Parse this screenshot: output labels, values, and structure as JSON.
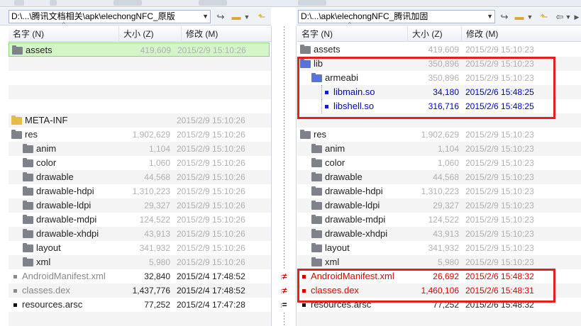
{
  "left": {
    "path": "D:\\...\\腾讯文档相关\\apk\\elechongNFC_原版",
    "rows": [
      {
        "idx": 0,
        "name": "assets",
        "size": "419,609",
        "date": "2015/2/9 15:10:26",
        "icon": "gray",
        "indent": 0,
        "style": "sel"
      },
      {
        "idx": 5,
        "name": "META-INF",
        "size": "",
        "date": "2015/2/9 15:10:26",
        "icon": "yellow",
        "indent": 0,
        "style": "folder"
      },
      {
        "idx": 6,
        "name": "res",
        "size": "1,902,629",
        "date": "2015/2/9 15:10:26",
        "icon": "gray",
        "indent": 0,
        "style": "folder"
      },
      {
        "idx": 7,
        "name": "anim",
        "size": "1,104",
        "date": "2015/2/9 15:10:26",
        "icon": "gray",
        "indent": 1,
        "style": "folder"
      },
      {
        "idx": 8,
        "name": "color",
        "size": "1,060",
        "date": "2015/2/9 15:10:26",
        "icon": "gray",
        "indent": 1,
        "style": "folder"
      },
      {
        "idx": 9,
        "name": "drawable",
        "size": "44,568",
        "date": "2015/2/9 15:10:26",
        "icon": "gray",
        "indent": 1,
        "style": "folder"
      },
      {
        "idx": 10,
        "name": "drawable-hdpi",
        "size": "1,310,223",
        "date": "2015/2/9 15:10:26",
        "icon": "gray",
        "indent": 1,
        "style": "folder"
      },
      {
        "idx": 11,
        "name": "drawable-ldpi",
        "size": "29,327",
        "date": "2015/2/9 15:10:26",
        "icon": "gray",
        "indent": 1,
        "style": "folder"
      },
      {
        "idx": 12,
        "name": "drawable-mdpi",
        "size": "124,522",
        "date": "2015/2/9 15:10:26",
        "icon": "gray",
        "indent": 1,
        "style": "folder"
      },
      {
        "idx": 13,
        "name": "drawable-xhdpi",
        "size": "43,913",
        "date": "2015/2/9 15:10:26",
        "icon": "gray",
        "indent": 1,
        "style": "folder"
      },
      {
        "idx": 14,
        "name": "layout",
        "size": "341,932",
        "date": "2015/2/9 15:10:26",
        "icon": "gray",
        "indent": 1,
        "style": "folder"
      },
      {
        "idx": 15,
        "name": "xml",
        "size": "5,980",
        "date": "2015/2/9 15:10:26",
        "icon": "gray",
        "indent": 1,
        "style": "folder"
      },
      {
        "idx": 16,
        "name": "AndroidManifest.xml",
        "size": "32,840",
        "date": "2015/2/4 17:48:52",
        "icon": "sq-grey",
        "indent": 0,
        "style": "diff"
      },
      {
        "idx": 17,
        "name": "classes.dex",
        "size": "1,437,776",
        "date": "2015/2/4 17:48:52",
        "icon": "sq-grey",
        "indent": 0,
        "style": "diff"
      },
      {
        "idx": 18,
        "name": "resources.arsc",
        "size": "77,252",
        "date": "2015/2/4 17:47:28",
        "icon": "sq-black",
        "indent": 0,
        "style": "same"
      }
    ]
  },
  "right": {
    "path": "D:\\...\\apk\\elechongNFC_腾讯加固",
    "rows": [
      {
        "idx": 0,
        "name": "assets",
        "size": "419,609",
        "date": "2015/2/9 15:10:23",
        "icon": "gray",
        "indent": 0,
        "style": "folder"
      },
      {
        "idx": 1,
        "name": "lib",
        "size": "350,896",
        "date": "2015/2/9 15:10:23",
        "icon": "blue",
        "indent": 0,
        "style": "folder"
      },
      {
        "idx": 2,
        "name": "armeabi",
        "size": "350,896",
        "date": "2015/2/9 15:10:23",
        "icon": "blue",
        "indent": 1,
        "style": "folder"
      },
      {
        "idx": 3,
        "name": "libmain.so",
        "size": "34,180",
        "date": "2015/2/6 15:48:25",
        "icon": "sq-blue",
        "indent": 2,
        "style": "new"
      },
      {
        "idx": 4,
        "name": "libshell.so",
        "size": "316,716",
        "date": "2015/2/6 15:48:25",
        "icon": "sq-blue",
        "indent": 2,
        "style": "new"
      },
      {
        "idx": 6,
        "name": "res",
        "size": "1,902,629",
        "date": "2015/2/9 15:10:23",
        "icon": "gray",
        "indent": 0,
        "style": "folder"
      },
      {
        "idx": 7,
        "name": "anim",
        "size": "1,104",
        "date": "2015/2/9 15:10:23",
        "icon": "gray",
        "indent": 1,
        "style": "folder"
      },
      {
        "idx": 8,
        "name": "color",
        "size": "1,060",
        "date": "2015/2/9 15:10:23",
        "icon": "gray",
        "indent": 1,
        "style": "folder"
      },
      {
        "idx": 9,
        "name": "drawable",
        "size": "44,568",
        "date": "2015/2/9 15:10:23",
        "icon": "gray",
        "indent": 1,
        "style": "folder"
      },
      {
        "idx": 10,
        "name": "drawable-hdpi",
        "size": "1,310,223",
        "date": "2015/2/9 15:10:23",
        "icon": "gray",
        "indent": 1,
        "style": "folder"
      },
      {
        "idx": 11,
        "name": "drawable-ldpi",
        "size": "29,327",
        "date": "2015/2/9 15:10:23",
        "icon": "gray",
        "indent": 1,
        "style": "folder"
      },
      {
        "idx": 12,
        "name": "drawable-mdpi",
        "size": "124,522",
        "date": "2015/2/9 15:10:23",
        "icon": "gray",
        "indent": 1,
        "style": "folder"
      },
      {
        "idx": 13,
        "name": "drawable-xhdpi",
        "size": "43,913",
        "date": "2015/2/9 15:10:23",
        "icon": "gray",
        "indent": 1,
        "style": "folder"
      },
      {
        "idx": 14,
        "name": "layout",
        "size": "341,932",
        "date": "2015/2/9 15:10:23",
        "icon": "gray",
        "indent": 1,
        "style": "folder"
      },
      {
        "idx": 15,
        "name": "xml",
        "size": "5,980",
        "date": "2015/2/9 15:10:23",
        "icon": "gray",
        "indent": 1,
        "style": "folder"
      },
      {
        "idx": 16,
        "name": "AndroidManifest.xml",
        "size": "26,692",
        "date": "2015/2/6 15:48:32",
        "icon": "sq-red",
        "indent": 0,
        "style": "diff"
      },
      {
        "idx": 17,
        "name": "classes.dex",
        "size": "1,460,106",
        "date": "2015/2/6 15:48:31",
        "icon": "sq-red",
        "indent": 0,
        "style": "diff"
      },
      {
        "idx": 18,
        "name": "resources.arsc",
        "size": "77,252",
        "date": "2015/2/6 15:48:32",
        "icon": "sq-black",
        "indent": 0,
        "style": "same"
      }
    ]
  },
  "columns": {
    "name": "名字 (N)",
    "size": "大小 (Z)",
    "modified": "修改 (M)"
  },
  "compare": [
    {
      "idx": 16,
      "symbol": "≠"
    },
    {
      "idx": 17,
      "symbol": "≠"
    },
    {
      "idx": 18,
      "symbol": "="
    }
  ],
  "colors": {
    "diff_red": "#e00000",
    "new_blue": "#0000d0",
    "highlight": "#e32020",
    "selected_bg": "#d4f5c8"
  }
}
